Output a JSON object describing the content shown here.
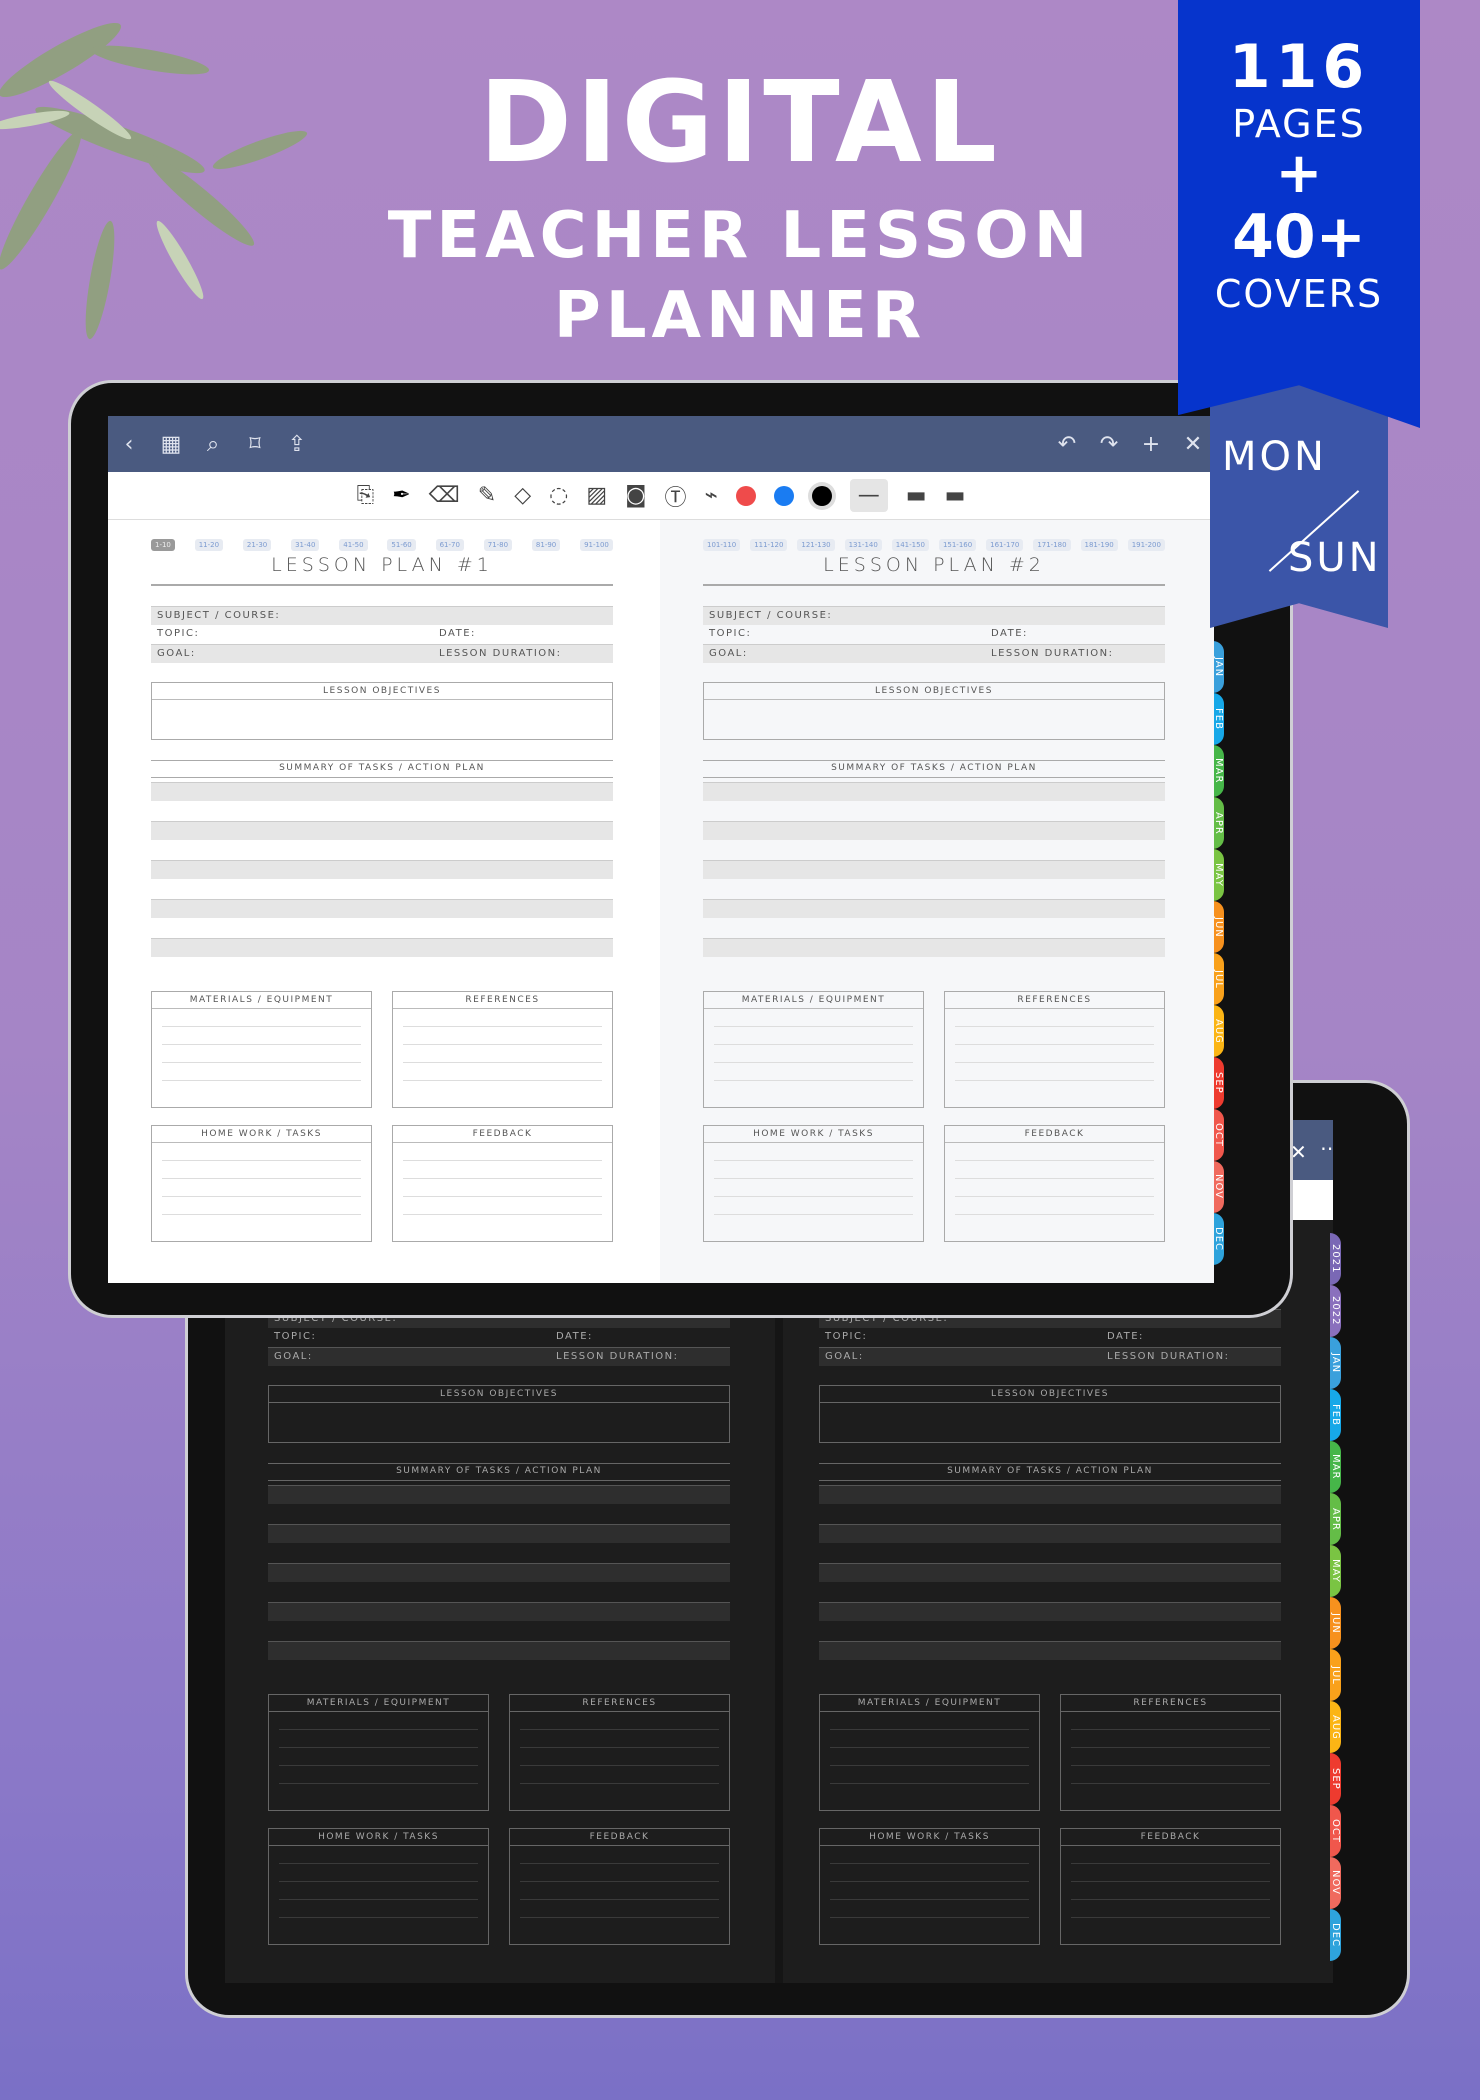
{
  "hero": {
    "line1": "DIGITAL",
    "line2": "TEACHER LESSON",
    "line3": "PLANNER"
  },
  "badge": {
    "count": "116",
    "pages": "PAGES",
    "plus": "+",
    "covers_count": "40+",
    "covers": "COVERS",
    "week_start_a": "MON",
    "week_start_b": "SUN"
  },
  "app": {
    "left_icons": [
      "back-icon",
      "grid-icon",
      "search-icon",
      "bookmark-icon",
      "share-icon"
    ],
    "right_icons": [
      "undo-icon",
      "redo-icon",
      "plus-icon",
      "close-icon"
    ],
    "tools": [
      "reader-mode-icon",
      "pen-icon",
      "eraser-icon",
      "highlighter-icon",
      "shapes-icon",
      "lasso-icon",
      "image-icon",
      "camera-icon",
      "text-icon",
      "laser-icon"
    ],
    "colors": [
      "#ef4b4b",
      "#1a7cf2",
      "#000000"
    ],
    "accent": "#4a5a80"
  },
  "pages": [
    {
      "tabs": [
        "1-10",
        "11-20",
        "21-30",
        "31-40",
        "41-50",
        "51-60",
        "61-70",
        "71-80",
        "81-90",
        "91-100"
      ],
      "active": 0,
      "title": "LESSON PLAN #1"
    },
    {
      "tabs": [
        "101-110",
        "111-120",
        "121-130",
        "131-140",
        "141-150",
        "151-160",
        "161-170",
        "171-180",
        "181-190",
        "191-200"
      ],
      "active": -1,
      "title": "LESSON PLAN #2"
    }
  ],
  "form": {
    "subject": "SUBJECT / COURSE:",
    "topic": "TOPIC:",
    "date": "DATE:",
    "goal": "GOAL:",
    "duration": "LESSON DURATION:",
    "objectives": "LESSON OBJECTIVES",
    "summary": "SUMMARY OF TASKS / ACTION PLAN",
    "materials": "MATERIALS / EQUIPMENT",
    "references": "REFERENCES",
    "homework": "HOME WORK / TASKS",
    "feedback": "FEEDBACK"
  },
  "months": [
    {
      "l": "JAN",
      "c": "#3aa0dc"
    },
    {
      "l": "FEB",
      "c": "#17a8e8"
    },
    {
      "l": "MAR",
      "c": "#46b649"
    },
    {
      "l": "APR",
      "c": "#64bd47"
    },
    {
      "l": "MAY",
      "c": "#7ac443"
    },
    {
      "l": "JUN",
      "c": "#f7911e"
    },
    {
      "l": "JUL",
      "c": "#f9a11b"
    },
    {
      "l": "AUG",
      "c": "#fbb515"
    },
    {
      "l": "SEP",
      "c": "#ee3b2f"
    },
    {
      "l": "OCT",
      "c": "#f0574c"
    },
    {
      "l": "NOV",
      "c": "#f06a5e"
    },
    {
      "l": "DEC",
      "c": "#2ea3dc"
    }
  ],
  "years": [
    {
      "l": "2021",
      "c": "#7a68b5"
    },
    {
      "l": "2022",
      "c": "#8a70bd"
    }
  ]
}
